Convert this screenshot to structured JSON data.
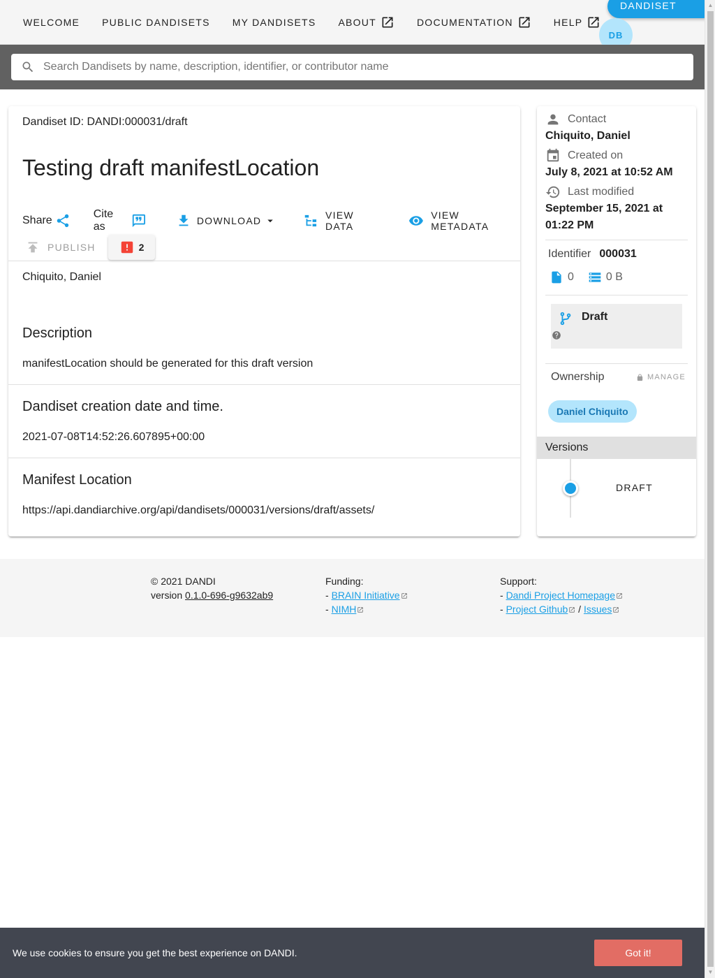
{
  "nav": {
    "items": [
      {
        "label": "Welcome"
      },
      {
        "label": "Public Dandisets"
      },
      {
        "label": "My Dandisets"
      },
      {
        "label": "About"
      },
      {
        "label": "Documentation"
      },
      {
        "label": "Help"
      }
    ],
    "new_button": "New Dandiset",
    "avatar_initials": "DB"
  },
  "search": {
    "placeholder": "Search Dandisets by name, description, identifier, or contributor name"
  },
  "dandiset": {
    "id_line": "Dandiset ID: DANDI:000031/draft",
    "title": "Testing draft manifestLocation",
    "actions": {
      "share": "Share",
      "cite": "Cite as",
      "download": "Download",
      "view_data": "View Data",
      "view_metadata": "View Metadata",
      "publish": "Publish",
      "issue_count": "2"
    },
    "contributors": "Chiquito, Daniel",
    "sections": [
      {
        "title": "Description",
        "body": "manifestLocation should be generated for this draft version"
      },
      {
        "title": "Dandiset creation date and time.",
        "body": "2021-07-08T14:52:26.607895+00:00"
      },
      {
        "title": "Manifest Location",
        "body": "https://api.dandiarchive.org/api/dandisets/000031/versions/draft/assets/"
      }
    ]
  },
  "side": {
    "contact_label": "Contact",
    "contact_value": "Chiquito, Daniel",
    "created_label": "Created on",
    "created_value": "July 8, 2021 at 10:52 AM",
    "modified_label": "Last modified",
    "modified_value": "September 15, 2021 at 01:22 PM",
    "identifier_label": "Identifier",
    "identifier_value": "000031",
    "file_count": "0",
    "size": "0 B",
    "status": "Draft",
    "ownership_label": "Ownership",
    "manage_label": "Manage",
    "owner": "Daniel Chiquito",
    "versions_label": "Versions",
    "version_item": "Draft"
  },
  "footer": {
    "copyright": "© 2021 DANDI",
    "version_prefix": "version",
    "version": "0.1.0-696-g9632ab9",
    "funding_label": "Funding:",
    "funding_links": [
      "BRAIN Initiative",
      "NIMH"
    ],
    "support_label": "Support:",
    "support_links": [
      "Dandi Project Homepage",
      "Project Github",
      "Issues"
    ],
    "bullet": "-",
    "sep": "/"
  },
  "cookie": {
    "text": "We use cookies to ensure you get the best experience on DANDI.",
    "button": "Got it!"
  },
  "colors": {
    "accent": "#1a9fe5",
    "error": "#f44336",
    "cookie_bg": "#424650",
    "cookie_button": "#e26d64"
  }
}
